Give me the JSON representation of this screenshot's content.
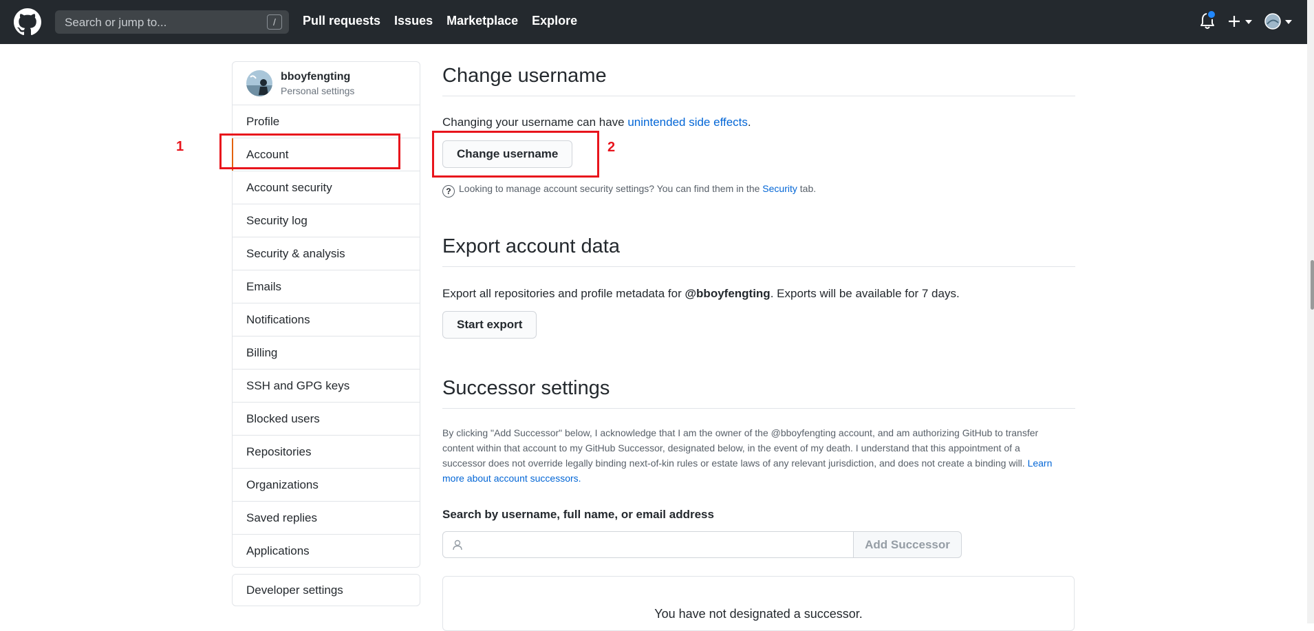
{
  "header": {
    "search_placeholder": "Search or jump to...",
    "search_key": "/",
    "nav": [
      "Pull requests",
      "Issues",
      "Marketplace",
      "Explore"
    ]
  },
  "sidebar": {
    "username": "bboyfengting",
    "subtitle": "Personal settings",
    "items": [
      {
        "label": "Profile",
        "selected": false
      },
      {
        "label": "Account",
        "selected": true
      },
      {
        "label": "Account security",
        "selected": false
      },
      {
        "label": "Security log",
        "selected": false
      },
      {
        "label": "Security & analysis",
        "selected": false
      },
      {
        "label": "Emails",
        "selected": false
      },
      {
        "label": "Notifications",
        "selected": false
      },
      {
        "label": "Billing",
        "selected": false
      },
      {
        "label": "SSH and GPG keys",
        "selected": false
      },
      {
        "label": "Blocked users",
        "selected": false
      },
      {
        "label": "Repositories",
        "selected": false
      },
      {
        "label": "Organizations",
        "selected": false
      },
      {
        "label": "Saved replies",
        "selected": false
      },
      {
        "label": "Applications",
        "selected": false
      }
    ],
    "developer_settings": "Developer settings"
  },
  "annotations": {
    "one": "1",
    "two": "2",
    "color": "#e8141c"
  },
  "change_username": {
    "title": "Change username",
    "text_before": "Changing your username can have ",
    "link": "unintended side effects",
    "text_after": ".",
    "button": "Change username",
    "note_before": "Looking to manage account security settings? You can find them in the ",
    "note_link": "Security",
    "note_after": " tab."
  },
  "export": {
    "title": "Export account data",
    "text_before": "Export all repositories and profile metadata for ",
    "handle": "@bboyfengting",
    "text_after": ". Exports will be available for 7 days.",
    "button": "Start export"
  },
  "successor": {
    "title": "Successor settings",
    "legal": "By clicking \"Add Successor\" below, I acknowledge that I am the owner of the @bboyfengting account, and am authorizing GitHub to transfer content within that account to my GitHub Successor, designated below, in the event of my death. I understand that this appointment of a successor does not override legally binding next-of-kin rules or estate laws of any relevant jurisdiction, and does not create a binding will. ",
    "legal_link": "Learn more about account successors.",
    "search_label": "Search by username, full name, or email address",
    "search_value": "",
    "add_button": "Add Successor",
    "empty": "You have not designated a successor."
  },
  "colors": {
    "header_bg": "#24292e",
    "link": "#0366d6",
    "selected_accent": "#e36209"
  }
}
